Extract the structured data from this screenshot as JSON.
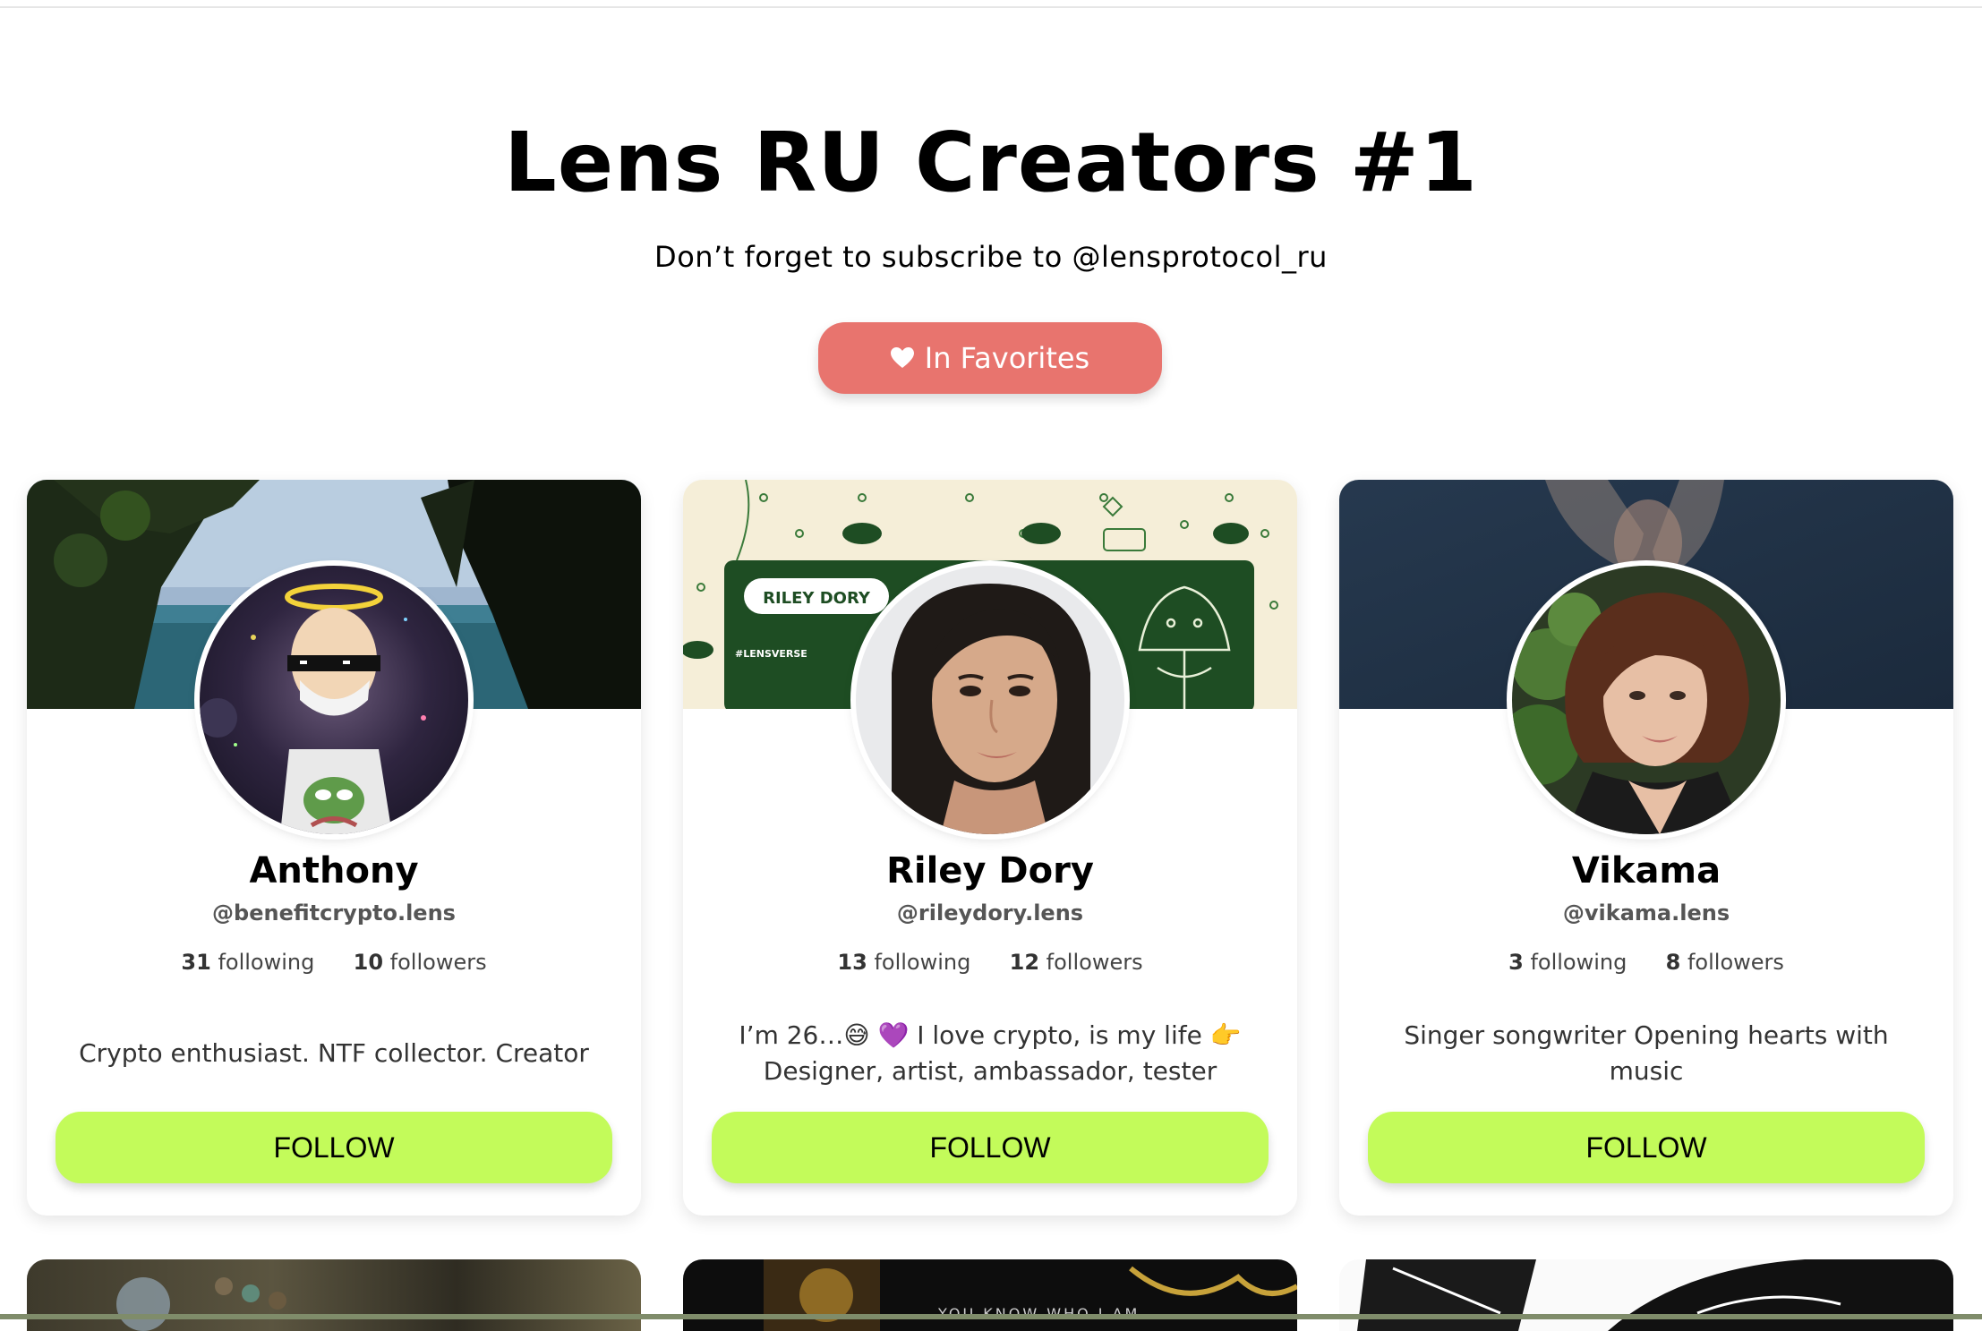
{
  "header": {
    "title": "Lens RU Creators #1",
    "subtitle": "Don’t forget to subscribe to @lensprotocol_ru",
    "favorites_label": "In Favorites"
  },
  "colors": {
    "favorites_button": "#e8746e",
    "follow_button": "#c3fb5a",
    "text": "#000000"
  },
  "cards": [
    {
      "name": "Anthony",
      "handle": "@benefitcrypto.lens",
      "following_count": "31",
      "following_label": "following",
      "followers_count": "10",
      "followers_label": "followers",
      "bio": "Crypto enthusiast. NTF collector. Creator",
      "follow_label": "FOLLOW"
    },
    {
      "name": "Riley Dory",
      "handle": "@rileydory.lens",
      "following_count": "13",
      "following_label": "following",
      "followers_count": "12",
      "followers_label": "followers",
      "bio": "I’m 26…😅 💜 I love crypto, is my life 👉 Designer, artist, ambassador, tester",
      "follow_label": "FOLLOW",
      "cover_badge": "RILEY DORY",
      "cover_tag": "#LENSVERSE"
    },
    {
      "name": "Vikama",
      "handle": "@vikama.lens",
      "following_count": "3",
      "following_label": "following",
      "followers_count": "8",
      "followers_label": "followers",
      "bio": "Singer songwriter Opening hearts with music",
      "follow_label": "FOLLOW"
    }
  ],
  "bottom_row": {
    "cover_text": "YOU KNOW WHO I AM."
  }
}
